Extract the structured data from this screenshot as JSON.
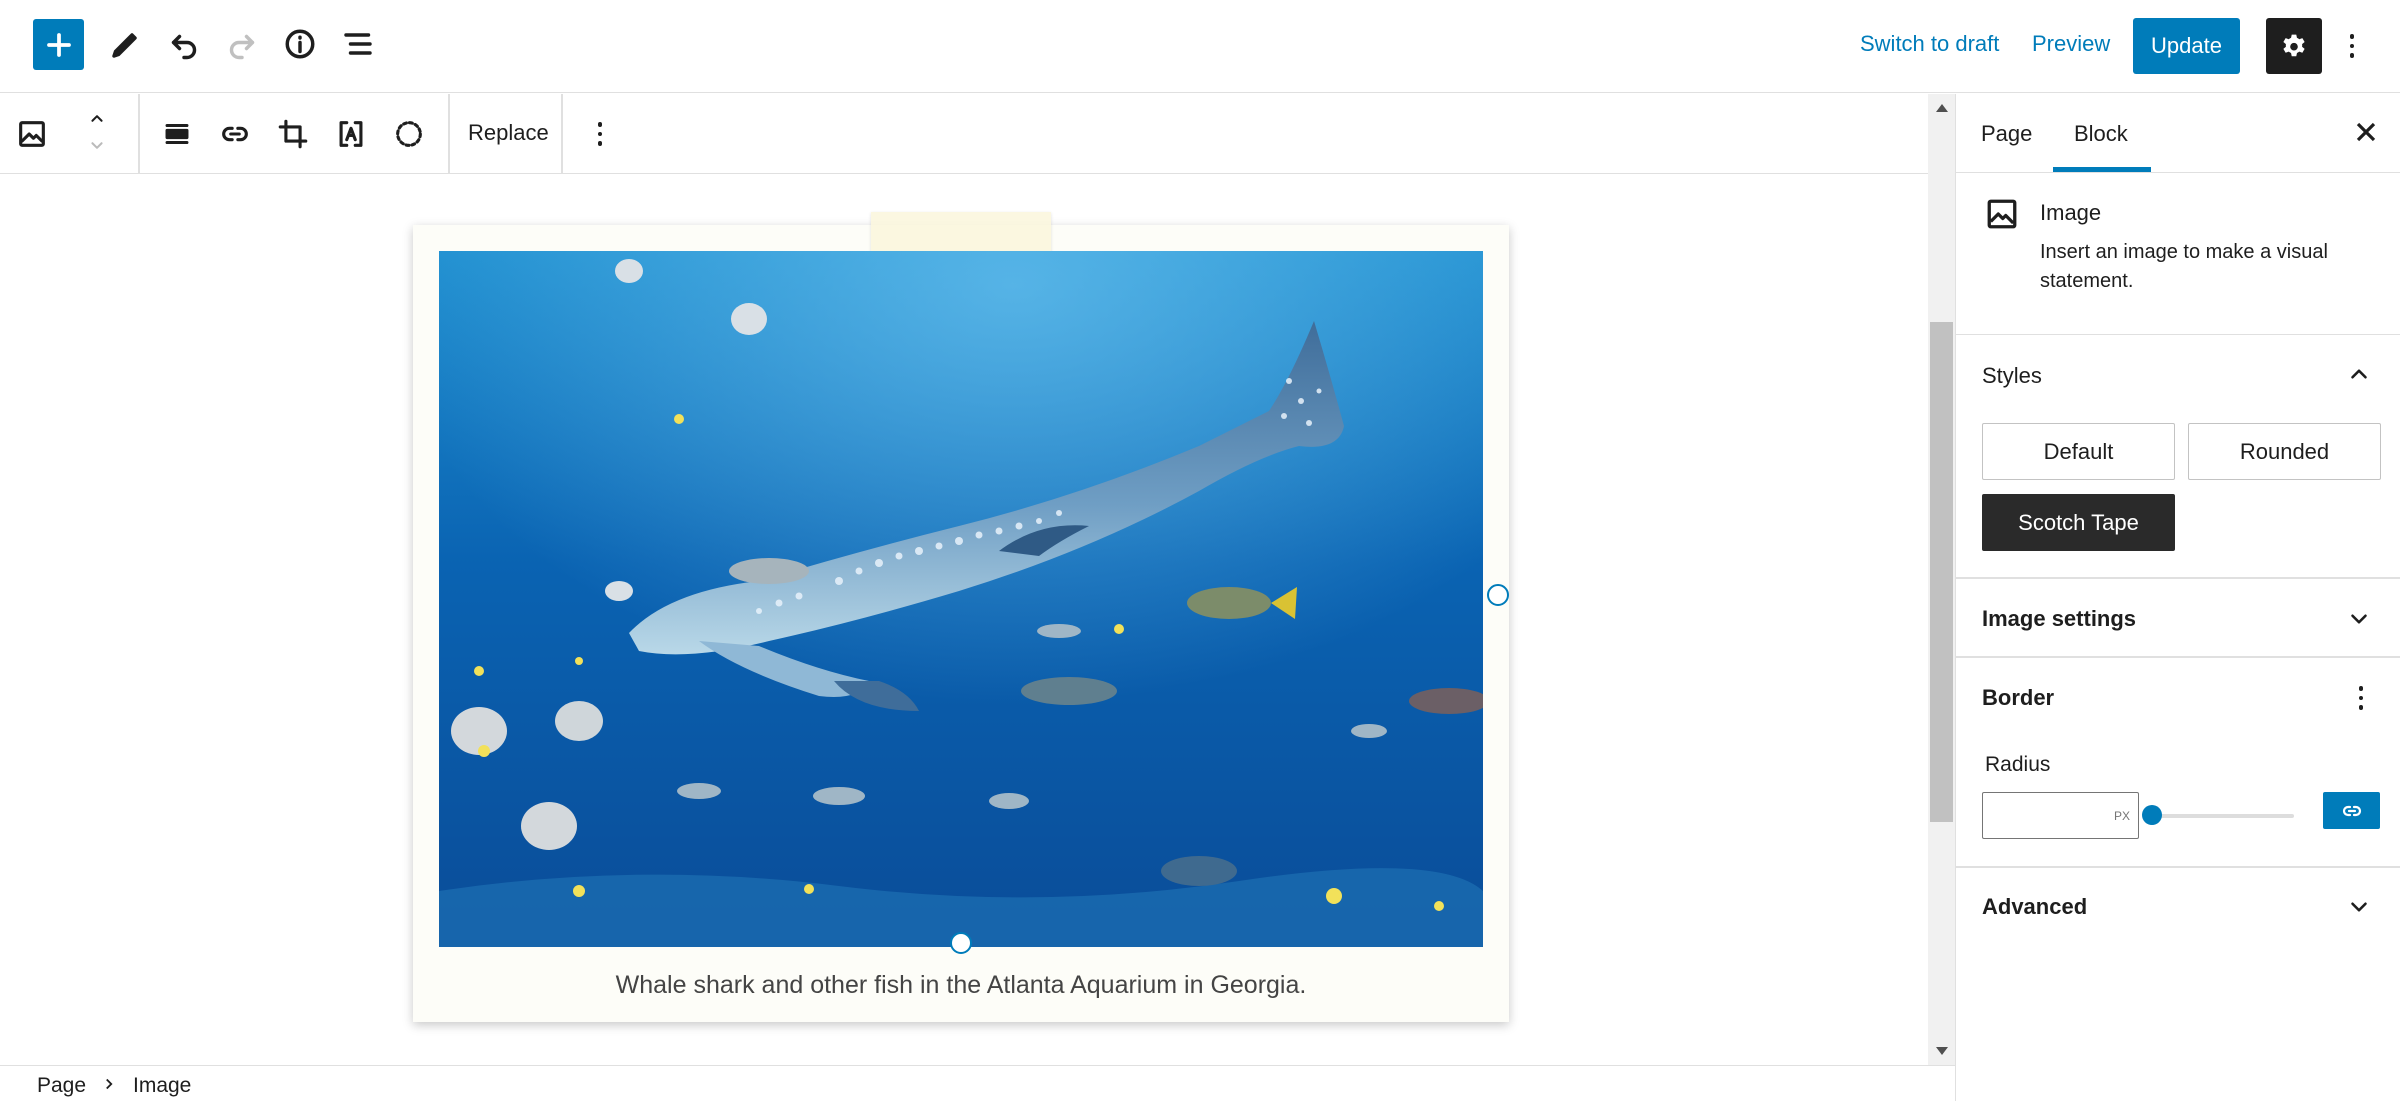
{
  "header": {
    "add_icon": "plus-icon",
    "tools_icon": "pencil-icon",
    "undo_icon": "undo-icon",
    "redo_icon": "redo-icon",
    "info_icon": "info-icon",
    "list_view_icon": "list-view-icon",
    "switch_to_draft": "Switch to draft",
    "preview": "Preview",
    "update": "Update",
    "settings_icon": "gear-icon",
    "options_icon": "kebab-icon"
  },
  "block_toolbar": {
    "block_type_icon": "image-icon",
    "move_up_icon": "chevron-up-icon",
    "move_down_icon": "chevron-down-icon",
    "align_icon": "align-icon",
    "link_icon": "link-icon",
    "crop_icon": "crop-icon",
    "text_overlay_icon": "text-overlay-icon",
    "select_icon": "dashed-circle-icon",
    "replace": "Replace",
    "more_icon": "kebab-icon"
  },
  "canvas": {
    "image_alt": "Whale shark and other fish in an aquarium",
    "caption": "Whale shark and other fish in the Atlanta Aquarium in Georgia."
  },
  "breadcrumb": {
    "items": [
      "Page",
      "Image"
    ]
  },
  "sidebar": {
    "tabs": [
      "Page",
      "Block"
    ],
    "active_tab": "Block",
    "block_card": {
      "title": "Image",
      "description": "Insert an image to make a visual statement."
    },
    "styles": {
      "title": "Styles",
      "options": [
        "Default",
        "Rounded",
        "Scotch Tape"
      ],
      "active": "Scotch Tape"
    },
    "image_settings": {
      "title": "Image settings"
    },
    "border": {
      "title": "Border",
      "radius_label": "Radius",
      "radius_value": "",
      "radius_unit": "PX",
      "slider_value": 0
    },
    "advanced": {
      "title": "Advanced"
    }
  },
  "colors": {
    "accent": "#007cba",
    "dark": "#1e1e1e",
    "border": "#e0e0e0"
  }
}
